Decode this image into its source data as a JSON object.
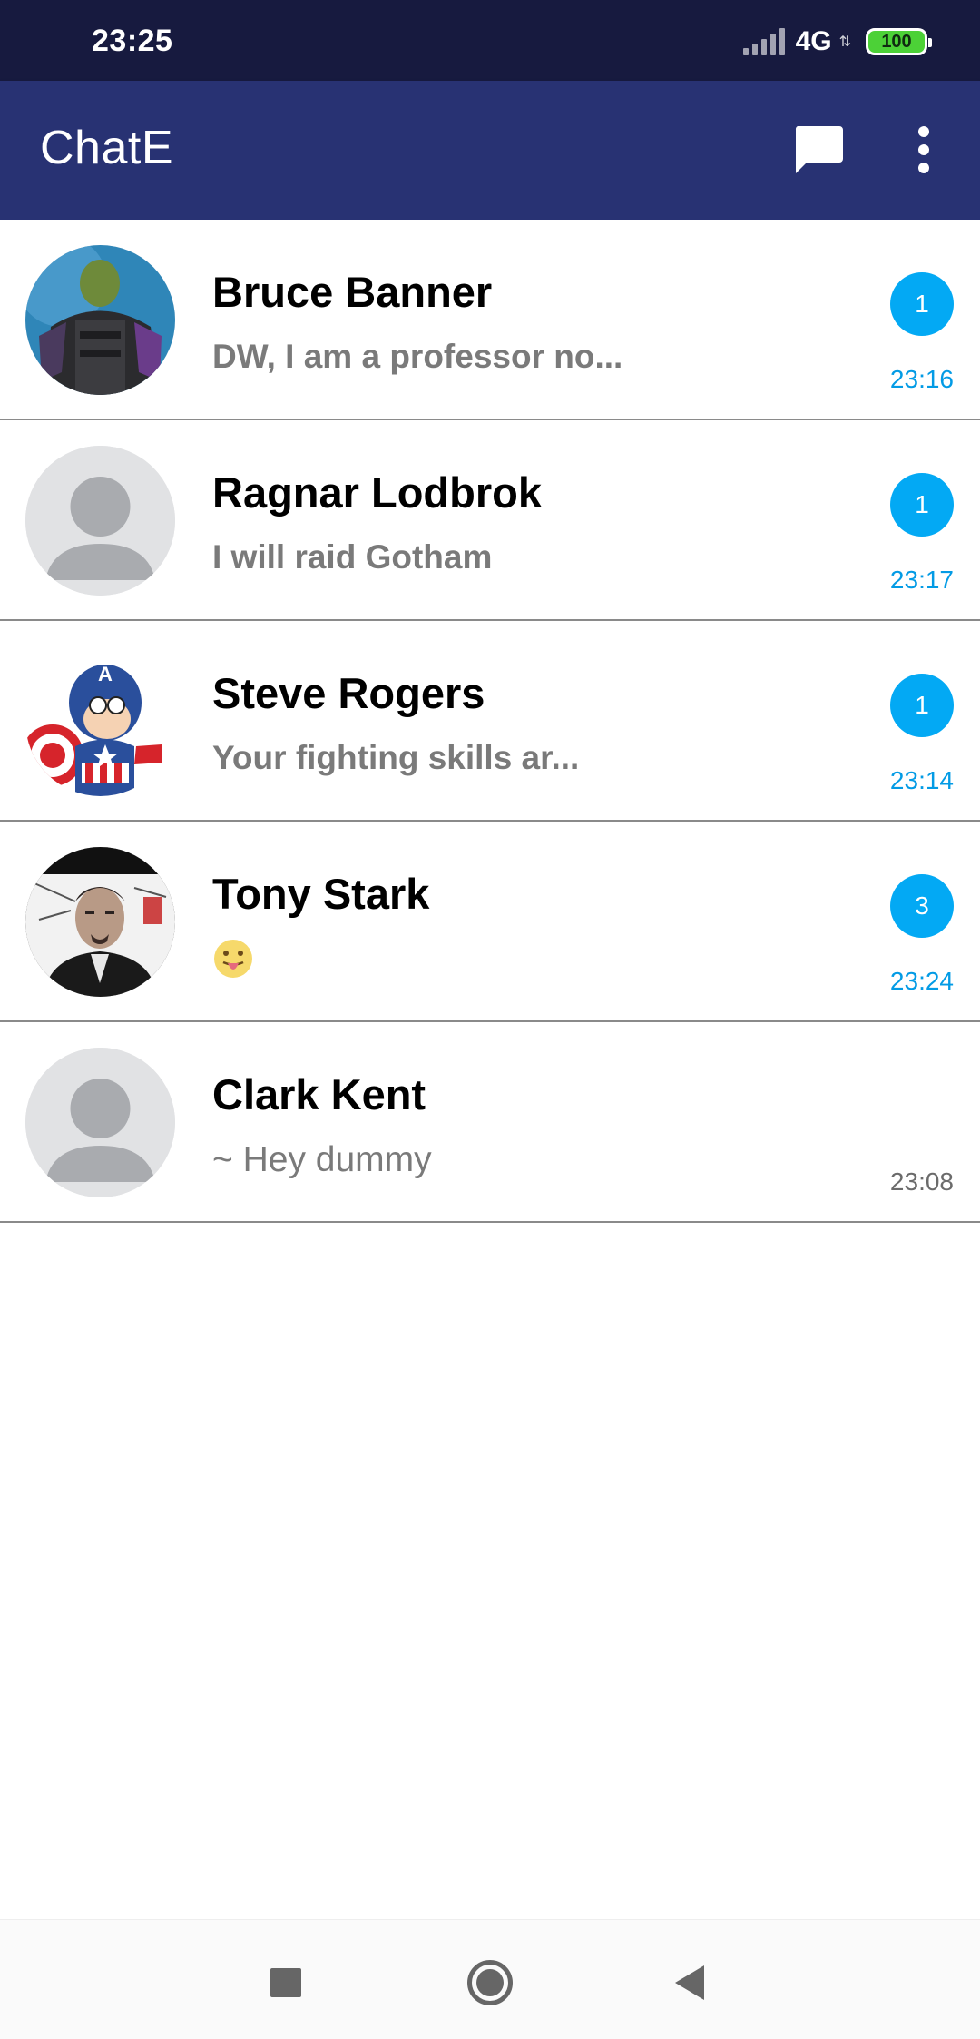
{
  "status_bar": {
    "time": "23:25",
    "network": "4G",
    "battery": "100",
    "icons": [
      "signal-icon",
      "network-arrows-icon",
      "battery-icon"
    ]
  },
  "app_bar": {
    "title": "ChatE",
    "icons": [
      "new-chat-icon",
      "more-vert-icon"
    ]
  },
  "chats": [
    {
      "name": "Bruce Banner",
      "message": "DW, I am a professor no...",
      "time": "23:16",
      "unread": "1",
      "avatar": "hulk-photo"
    },
    {
      "name": "Ragnar Lodbrok",
      "message": "I will raid Gotham",
      "time": "23:17",
      "unread": "1",
      "avatar": "default-person-icon"
    },
    {
      "name": "Steve Rogers",
      "message": "Your fighting skills ar...",
      "time": "23:14",
      "unread": "1",
      "avatar": "captain-america-cartoon"
    },
    {
      "name": "Tony Stark",
      "message": "",
      "message_emoji": "tongue-out-emoji",
      "time": "23:24",
      "unread": "3",
      "avatar": "tony-stark-photo"
    },
    {
      "name": "Clark Kent",
      "message": "~ Hey dummy",
      "time": "23:08",
      "unread": "",
      "avatar": "default-person-icon"
    }
  ],
  "colors": {
    "status_bar": "#171a3f",
    "app_bar": "#283273",
    "badge": "#03a9f4",
    "unread_time": "#039be5",
    "read_time": "#6b6b6b",
    "message_text": "#7a7a7a"
  },
  "nav_bar": {
    "icons": [
      "recents-square-icon",
      "home-circle-icon",
      "back-triangle-icon"
    ]
  }
}
